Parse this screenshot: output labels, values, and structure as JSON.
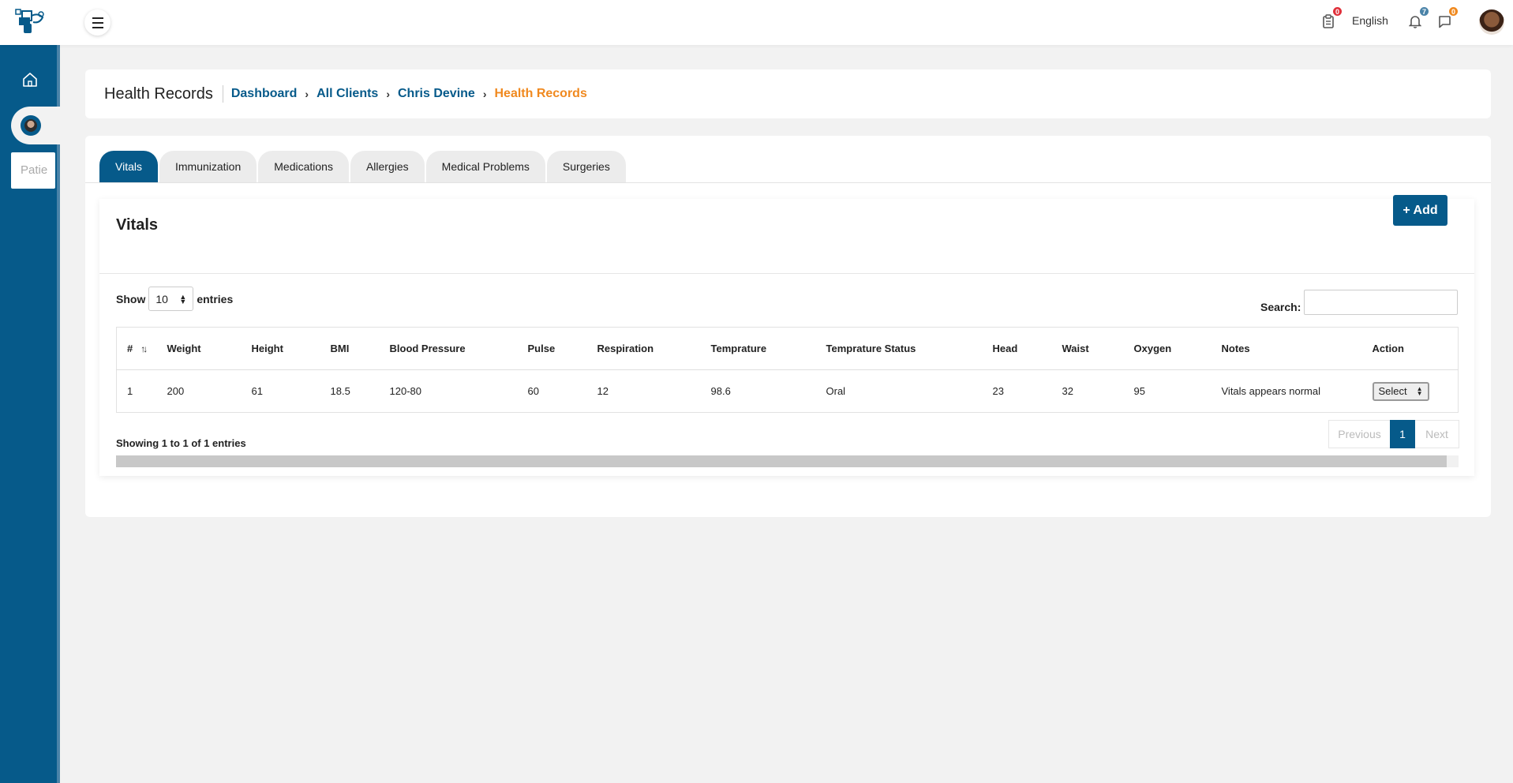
{
  "header": {
    "language": "English",
    "badges": {
      "tasks": "0",
      "notifications": "7",
      "messages": "0"
    },
    "colors": {
      "tasks_badge": "#e0303a",
      "notifications_badge": "#4a83a8",
      "messages_badge": "#f0891f"
    },
    "icons": [
      "logo-icon",
      "menu-icon",
      "clipboard-icon",
      "bell-icon",
      "chat-icon",
      "user-avatar"
    ]
  },
  "sidebar": {
    "tooltip_text": "Patie",
    "icons": [
      "home-icon",
      "patient-avatar-icon"
    ]
  },
  "page": {
    "title": "Health Records",
    "breadcrumbs": [
      {
        "label": "Dashboard"
      },
      {
        "label": "All Clients"
      },
      {
        "label": "Chris Devine"
      },
      {
        "label": "Health Records"
      }
    ]
  },
  "tabs": [
    {
      "label": "Vitals",
      "active": true
    },
    {
      "label": "Immunization"
    },
    {
      "label": "Medications"
    },
    {
      "label": "Allergies"
    },
    {
      "label": "Medical Problems"
    },
    {
      "label": "Surgeries"
    }
  ],
  "vitals": {
    "title": "Vitals",
    "add_label": "+ Add",
    "show_label": "Show",
    "entries_label": "entries",
    "page_length": "10",
    "search_label": "Search:",
    "search_value": "",
    "columns": [
      "#",
      "Weight",
      "Height",
      "BMI",
      "Blood Pressure",
      "Pulse",
      "Respiration",
      "Temprature",
      "Temprature Status",
      "Head",
      "Waist",
      "Oxygen",
      "Notes",
      "Action"
    ],
    "rows": [
      {
        "num": "1",
        "weight": "200",
        "height": "61",
        "bmi": "18.5",
        "bp": "120-80",
        "pulse": "60",
        "respiration": "12",
        "temp": "98.6",
        "temp_status": "Oral",
        "head": "23",
        "waist": "32",
        "oxygen": "95",
        "notes": "Vitals appears normal",
        "action": "Select"
      }
    ],
    "info": "Showing 1 to 1 of 1 entries",
    "pagination": {
      "previous": "Previous",
      "current": "1",
      "next": "Next"
    }
  },
  "accent_color": "#065a8a",
  "breadcrumb_current_color": "#f0891f"
}
